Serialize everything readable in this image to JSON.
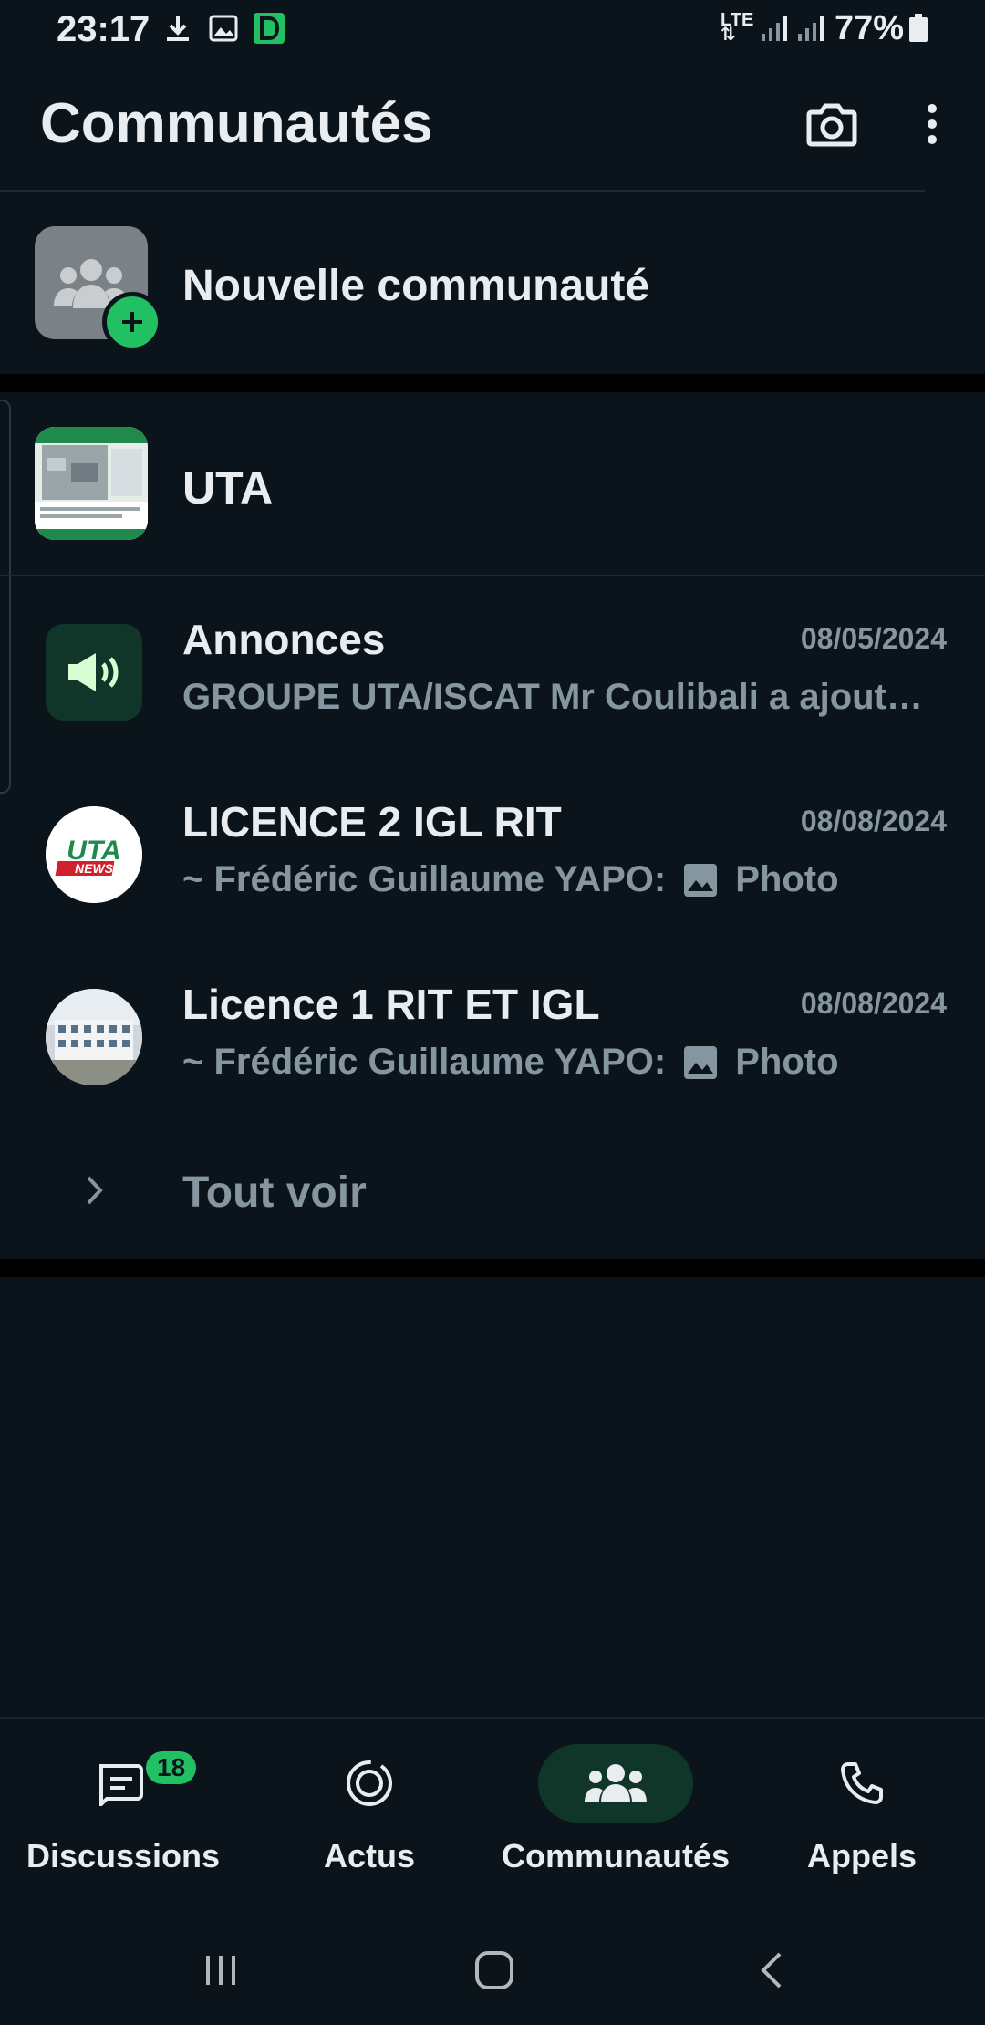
{
  "status_bar": {
    "time": "23:17",
    "network": "LTE",
    "battery": "77%"
  },
  "header": {
    "title": "Communautés"
  },
  "new_community": {
    "label": "Nouvelle communauté"
  },
  "community": {
    "name": "UTA",
    "groups": [
      {
        "title": "Annonces",
        "date": "08/05/2024",
        "subtitle": "GROUPE UTA/ISCAT Mr Coulibali a ajout…"
      },
      {
        "title": "LICENCE 2 IGL RIT",
        "date": "08/08/2024",
        "sender": "~ Frédéric Guillaume YAPO:",
        "media": "Photo"
      },
      {
        "title": "Licence 1 RIT ET IGL",
        "date": "08/08/2024",
        "sender": "~ Frédéric Guillaume YAPO:",
        "media": "Photo"
      }
    ],
    "see_all": "Tout voir",
    "uta_news_logo": {
      "line1": "UTA",
      "line2": "NEWS"
    }
  },
  "bottom_nav": {
    "items": [
      {
        "label": "Discussions",
        "badge": "18",
        "icon": "chat-icon"
      },
      {
        "label": "Actus",
        "icon": "updates-icon"
      },
      {
        "label": "Communautés",
        "icon": "communities-icon",
        "active": true
      },
      {
        "label": "Appels",
        "icon": "phone-icon"
      }
    ]
  },
  "colors": {
    "background": "#0b141b",
    "accent": "#21c063",
    "active_tab": "#103529",
    "secondary_text": "#8696a0"
  }
}
